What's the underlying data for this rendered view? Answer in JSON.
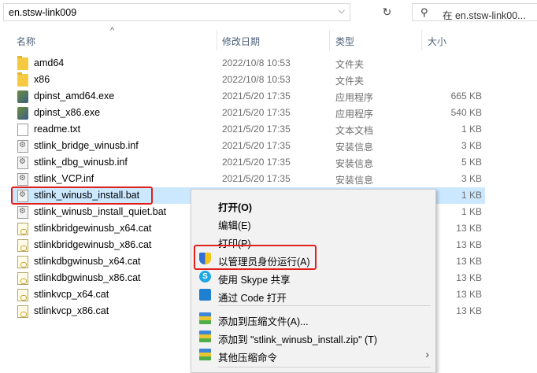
{
  "address": {
    "path": "en.stsw-link009"
  },
  "search": {
    "placeholder": "在 en.stsw-link00..."
  },
  "columns": {
    "name": "名称",
    "date": "修改日期",
    "type": "类型",
    "size": "大小"
  },
  "files": [
    {
      "name": "amd64",
      "date": "2022/10/8 10:53",
      "type": "文件夹",
      "size": "",
      "icon": "folder-icon"
    },
    {
      "name": "x86",
      "date": "2022/10/8 10:53",
      "type": "文件夹",
      "size": "",
      "icon": "folder-icon"
    },
    {
      "name": "dpinst_amd64.exe",
      "date": "2021/5/20 17:35",
      "type": "应用程序",
      "size": "665 KB",
      "icon": "exe-icon"
    },
    {
      "name": "dpinst_x86.exe",
      "date": "2021/5/20 17:35",
      "type": "应用程序",
      "size": "540 KB",
      "icon": "exe-icon"
    },
    {
      "name": "readme.txt",
      "date": "2021/5/20 17:35",
      "type": "文本文档",
      "size": "1 KB",
      "icon": "text-file-icon"
    },
    {
      "name": "stlink_bridge_winusb.inf",
      "date": "2021/5/20 17:35",
      "type": "安装信息",
      "size": "3 KB",
      "icon": "setup-info-icon"
    },
    {
      "name": "stlink_dbg_winusb.inf",
      "date": "2021/5/20 17:35",
      "type": "安装信息",
      "size": "5 KB",
      "icon": "setup-info-icon"
    },
    {
      "name": "stlink_VCP.inf",
      "date": "2021/5/20 17:35",
      "type": "安装信息",
      "size": "3 KB",
      "icon": "setup-info-icon"
    },
    {
      "name": "stlink_winusb_install.bat",
      "date": "",
      "type": "",
      "size": "1 KB",
      "icon": "batch-file-icon"
    },
    {
      "name": "stlink_winusb_install_quiet.bat",
      "date": "",
      "type": "",
      "size": "1 KB",
      "icon": "batch-file-icon"
    },
    {
      "name": "stlinkbridgewinusb_x64.cat",
      "date": "",
      "type": "",
      "size": "13 KB",
      "icon": "catalog-file-icon"
    },
    {
      "name": "stlinkbridgewinusb_x86.cat",
      "date": "",
      "type": "",
      "size": "13 KB",
      "icon": "catalog-file-icon"
    },
    {
      "name": "stlinkdbgwinusb_x64.cat",
      "date": "",
      "type": "",
      "size": "13 KB",
      "icon": "catalog-file-icon"
    },
    {
      "name": "stlinkdbgwinusb_x86.cat",
      "date": "",
      "type": "",
      "size": "13 KB",
      "icon": "catalog-file-icon"
    },
    {
      "name": "stlinkvcp_x64.cat",
      "date": "",
      "type": "",
      "size": "13 KB",
      "icon": "catalog-file-icon"
    },
    {
      "name": "stlinkvcp_x86.cat",
      "date": "",
      "type": "",
      "size": "13 KB",
      "icon": "catalog-file-icon"
    }
  ],
  "context_menu": {
    "items": [
      {
        "label": "打开(O)",
        "bold": true,
        "icon": ""
      },
      {
        "label": "编辑(E)",
        "icon": ""
      },
      {
        "label": "打印(P)",
        "icon": ""
      },
      {
        "label": "以管理员身份运行(A)",
        "icon": "uac-shield-icon"
      },
      {
        "label": "使用 Skype 共享",
        "icon": "skype-icon"
      },
      {
        "label": "通过 Code 打开",
        "icon": "vscode-icon"
      },
      {
        "label": "添加到压缩文件(A)...",
        "icon": "archive-icon"
      },
      {
        "label": "添加到 \"stlink_winusb_install.zip\" (T)",
        "icon": "archive-icon"
      },
      {
        "label": "其他压缩命令",
        "icon": "archive-icon",
        "submenu": true
      }
    ]
  },
  "colors": {
    "selection": "#cce8ff",
    "highlight_box": "#e0201c",
    "menu_bg": "#f2f2f2"
  }
}
